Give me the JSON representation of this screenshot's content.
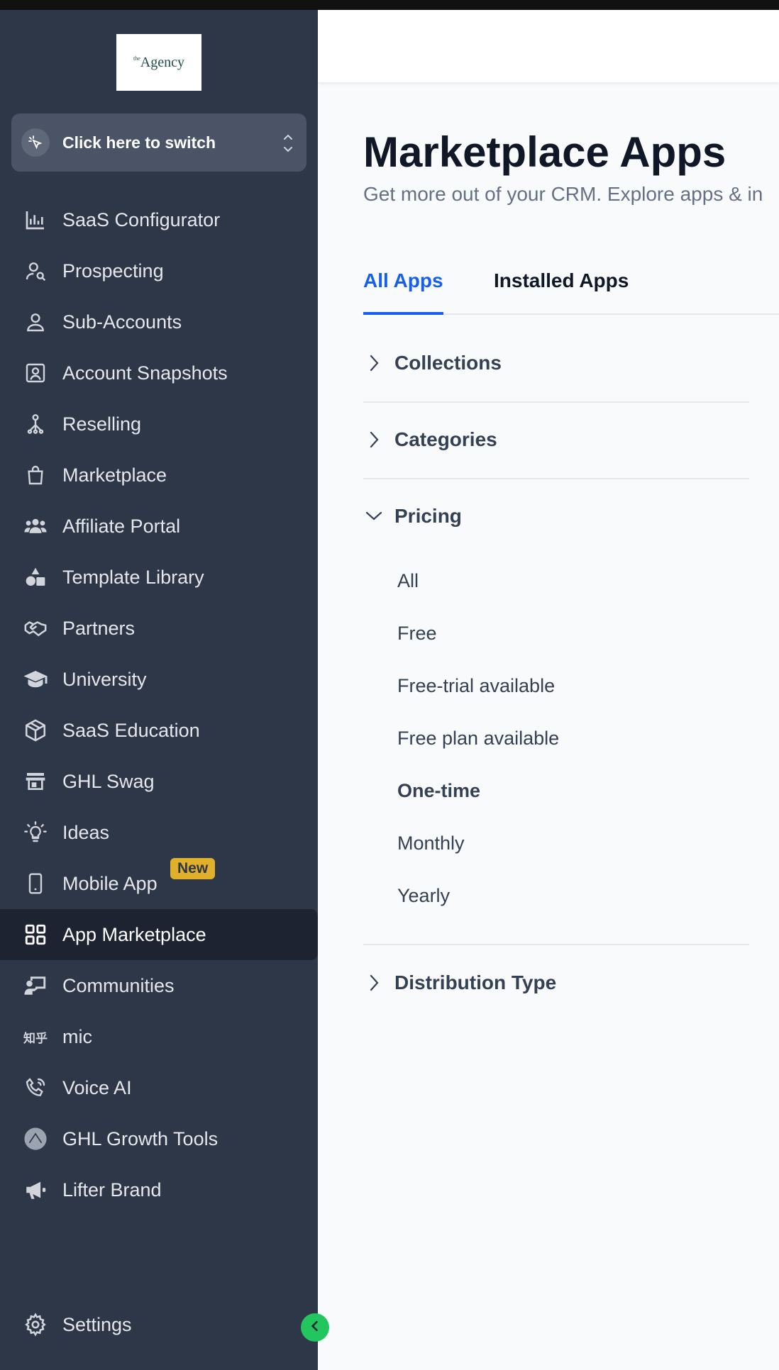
{
  "app": {
    "logo_small": "the",
    "logo_text": "Agency",
    "switcher_label": "Click here to switch"
  },
  "sidebar": {
    "items": [
      {
        "label": "SaaS Configurator",
        "icon": "bar-chart-icon"
      },
      {
        "label": "Prospecting",
        "icon": "user-search-icon"
      },
      {
        "label": "Sub-Accounts",
        "icon": "user-icon"
      },
      {
        "label": "Account Snapshots",
        "icon": "portrait-icon"
      },
      {
        "label": "Reselling",
        "icon": "network-icon"
      },
      {
        "label": "Marketplace",
        "icon": "shopping-bag-icon"
      },
      {
        "label": "Affiliate Portal",
        "icon": "users-icon"
      },
      {
        "label": "Template Library",
        "icon": "shapes-icon"
      },
      {
        "label": "Partners",
        "icon": "handshake-icon"
      },
      {
        "label": "University",
        "icon": "graduation-cap-icon"
      },
      {
        "label": "SaaS Education",
        "icon": "box-icon"
      },
      {
        "label": "GHL Swag",
        "icon": "store-icon"
      },
      {
        "label": "Ideas",
        "icon": "lightbulb-icon"
      },
      {
        "label": "Mobile App",
        "icon": "phone-icon",
        "badge": "New"
      },
      {
        "label": "App Marketplace",
        "icon": "grid-icon",
        "active": true
      },
      {
        "label": "Communities",
        "icon": "presentation-icon"
      },
      {
        "label": "mic",
        "icon": "zhihu-icon",
        "icon_text": "知乎"
      },
      {
        "label": "Voice AI",
        "icon": "phone-call-icon"
      },
      {
        "label": "GHL Growth Tools",
        "icon": "growth-icon"
      },
      {
        "label": "Lifter Brand",
        "icon": "megaphone-icon"
      }
    ],
    "settings_label": "Settings"
  },
  "main": {
    "title": "Marketplace Apps",
    "subtitle": "Get more out of your CRM. Explore apps & in",
    "tabs": [
      {
        "label": "All Apps",
        "active": true
      },
      {
        "label": "Installed Apps",
        "active": false
      }
    ],
    "filters": {
      "collections": "Collections",
      "categories": "Categories",
      "pricing": "Pricing",
      "pricing_options": [
        {
          "label": "All",
          "selected": false
        },
        {
          "label": "Free",
          "selected": false
        },
        {
          "label": "Free-trial available",
          "selected": false
        },
        {
          "label": "Free plan available",
          "selected": false
        },
        {
          "label": "One-time",
          "selected": true
        },
        {
          "label": "Monthly",
          "selected": false
        },
        {
          "label": "Yearly",
          "selected": false
        }
      ],
      "distribution": "Distribution Type"
    }
  },
  "colors": {
    "sidebar_bg": "#2e3748",
    "accent": "#155eef",
    "badge": "#e0b02b",
    "collapse": "#22c55e"
  }
}
